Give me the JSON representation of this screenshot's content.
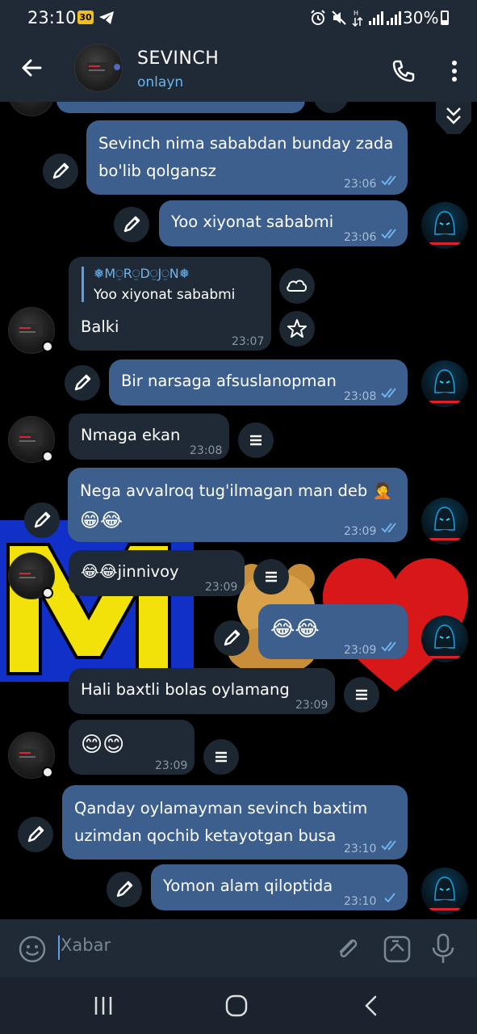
{
  "status_bar": {
    "time": "23:10",
    "badge": "30",
    "battery": "30%"
  },
  "header": {
    "name": "SEVINCH",
    "status": "onlayn"
  },
  "messages": [
    {
      "id": "m1",
      "text_line1": "Sevinch nima sababdan bunday zada",
      "text_line2": "bo'lib qolgansz",
      "time": "23:06",
      "dir": "out",
      "read": true
    },
    {
      "id": "m2",
      "text": "Yoo xiyonat sababmi",
      "time": "23:06",
      "dir": "out",
      "read": true
    },
    {
      "id": "m3",
      "reply_author": "❅M⍜R⍜D⍜J⍜N❅",
      "reply_text": "Yoo xiyonat sababmi",
      "text": "Balki",
      "time": "23:07",
      "dir": "in"
    },
    {
      "id": "m4",
      "text": "Bir narsaga afsuslanopman",
      "time": "23:08",
      "dir": "out",
      "read": true
    },
    {
      "id": "m5",
      "text": "Nmaga ekan",
      "time": "23:08",
      "dir": "in"
    },
    {
      "id": "m6",
      "text_line1": "Nega avvalroq tug'ilmagan man deb 🤦",
      "text_line2": "😁😂",
      "time": "23:09",
      "dir": "out",
      "read": true
    },
    {
      "id": "m7",
      "text": "😂😂jinnivoy",
      "time": "23:09",
      "dir": "in"
    },
    {
      "id": "m8",
      "text": "😂😂",
      "time": "23:09",
      "dir": "out",
      "read": true
    },
    {
      "id": "m9",
      "text": "Hali baxtli bolas oylamang",
      "time": "23:09",
      "dir": "in"
    },
    {
      "id": "m10",
      "text": "😊😊",
      "time": "23:09",
      "dir": "in"
    },
    {
      "id": "m11",
      "text_line1": "Qanday oylamayman sevinch baxtim",
      "text_line2": "uzimdan qochib ketayotgan busa",
      "time": "23:10",
      "dir": "out",
      "read": true
    },
    {
      "id": "m12",
      "text": "Yomon alam qiloptida",
      "time": "23:10",
      "dir": "out",
      "read": false
    }
  ],
  "composer": {
    "placeholder": "Xabar"
  },
  "colors": {
    "accent": "#5ba1e6",
    "bubble_out": "#3d5f8d",
    "bubble_in": "#1f2a36",
    "header": "#1f2a36"
  }
}
